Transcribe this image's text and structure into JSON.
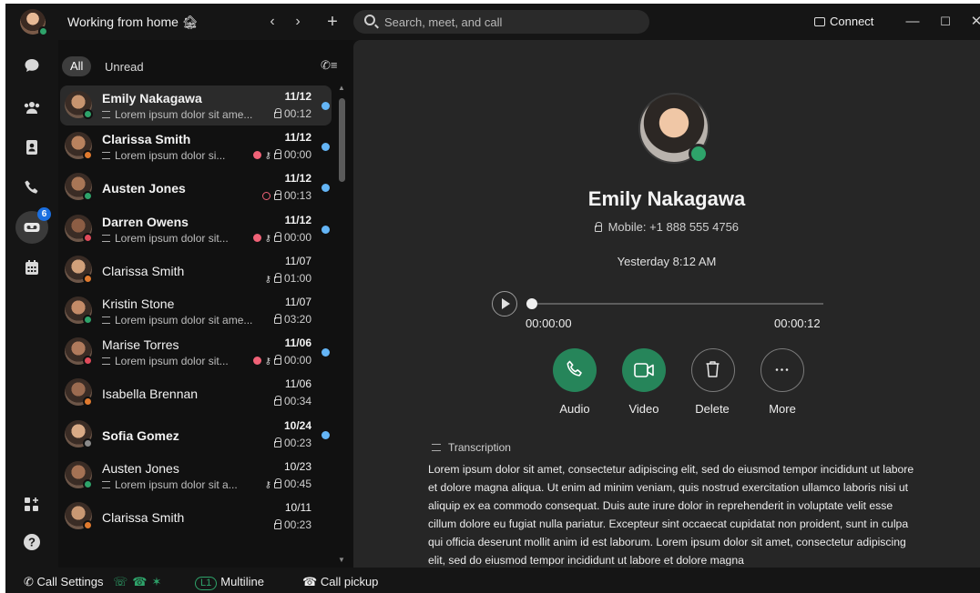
{
  "titlebar": {
    "workspace_title": "Working from home 🏚",
    "search_placeholder": "Search, meet, and call",
    "connect_label": "Connect"
  },
  "rail": {
    "voicemail_badge": "6"
  },
  "list": {
    "filter_all": "All",
    "filter_unread": "Unread",
    "items": [
      {
        "name": "Emily Nakagawa",
        "bold": true,
        "preview": "Lorem ipsum dolor sit ame...",
        "date": "11/12",
        "duration": "00:12",
        "unread": true,
        "selected": true
      },
      {
        "name": "Clarissa Smith",
        "bold": true,
        "preview": "Lorem ipsum dolor si...",
        "date": "11/12",
        "duration": "00:00",
        "unread": true,
        "urgent": true,
        "key": true
      },
      {
        "name": "Austen Jones",
        "bold": true,
        "preview": "",
        "date": "11/12",
        "duration": "00:13",
        "unread": true,
        "alarm": true
      },
      {
        "name": "Darren Owens",
        "bold": true,
        "preview": "Lorem ipsum dolor sit...",
        "date": "11/12",
        "duration": "00:00",
        "unread": true,
        "urgent": true,
        "key": true
      },
      {
        "name": "Clarissa Smith",
        "bold": false,
        "preview": "",
        "date": "11/07",
        "duration": "01:00",
        "unread": false,
        "key": true
      },
      {
        "name": "Kristin Stone",
        "bold": false,
        "preview": "Lorem ipsum dolor sit ame...",
        "date": "11/07",
        "duration": "03:20",
        "unread": false
      },
      {
        "name": "Marise Torres",
        "bold": false,
        "preview": "Lorem ipsum dolor sit...",
        "date": "11/06",
        "duration": "00:00",
        "unread": true,
        "urgent": true,
        "key": true
      },
      {
        "name": "Isabella Brennan",
        "bold": false,
        "preview": "",
        "date": "11/06",
        "duration": "00:34",
        "unread": false
      },
      {
        "name": "Sofia Gomez",
        "bold": true,
        "preview": "",
        "date": "10/24",
        "duration": "00:23",
        "unread": true
      },
      {
        "name": "Austen Jones",
        "bold": false,
        "preview": "Lorem ipsum dolor sit a...",
        "date": "10/23",
        "duration": "00:45",
        "unread": false,
        "key": true
      },
      {
        "name": "Clarissa Smith",
        "bold": false,
        "preview": "",
        "date": "10/11",
        "duration": "00:23",
        "unread": false
      }
    ]
  },
  "detail": {
    "name": "Emily Nakagawa",
    "mobile": "Mobile: +1 888 555 4756",
    "time": "Yesterday 8:12 AM",
    "position": "00:00:00",
    "length": "00:00:12",
    "progress": 0,
    "actions": {
      "audio": "Audio",
      "video": "Video",
      "delete": "Delete",
      "more": "More"
    },
    "transcription_title": "Transcription",
    "transcription": "Lorem ipsum dolor sit amet, consectetur adipiscing elit, sed do eiusmod tempor incididunt ut labore et dolore magna aliqua. Ut enim ad minim veniam, quis nostrud exercitation ullamco laboris nisi ut aliquip ex ea commodo consequat. Duis aute irure dolor in reprehenderit in voluptate velit esse cillum dolore eu fugiat nulla pariatur. Excepteur sint occaecat cupidatat non proident, sunt in culpa qui officia deserunt mollit anim id est laborum. Lorem ipsum dolor sit amet, consectetur adipiscing elit, sed do eiusmod tempor incididunt ut labore et dolore magna"
  },
  "footer": {
    "call_settings": "Call Settings",
    "line_badge": "L1",
    "multiline": "Multiline",
    "call_pickup": "Call pickup"
  },
  "colors": {
    "accent_green": "#26855a",
    "unread_dot": "#64b5f6",
    "urgent_red": "#f06277",
    "badge_blue": "#1b6fe0"
  }
}
